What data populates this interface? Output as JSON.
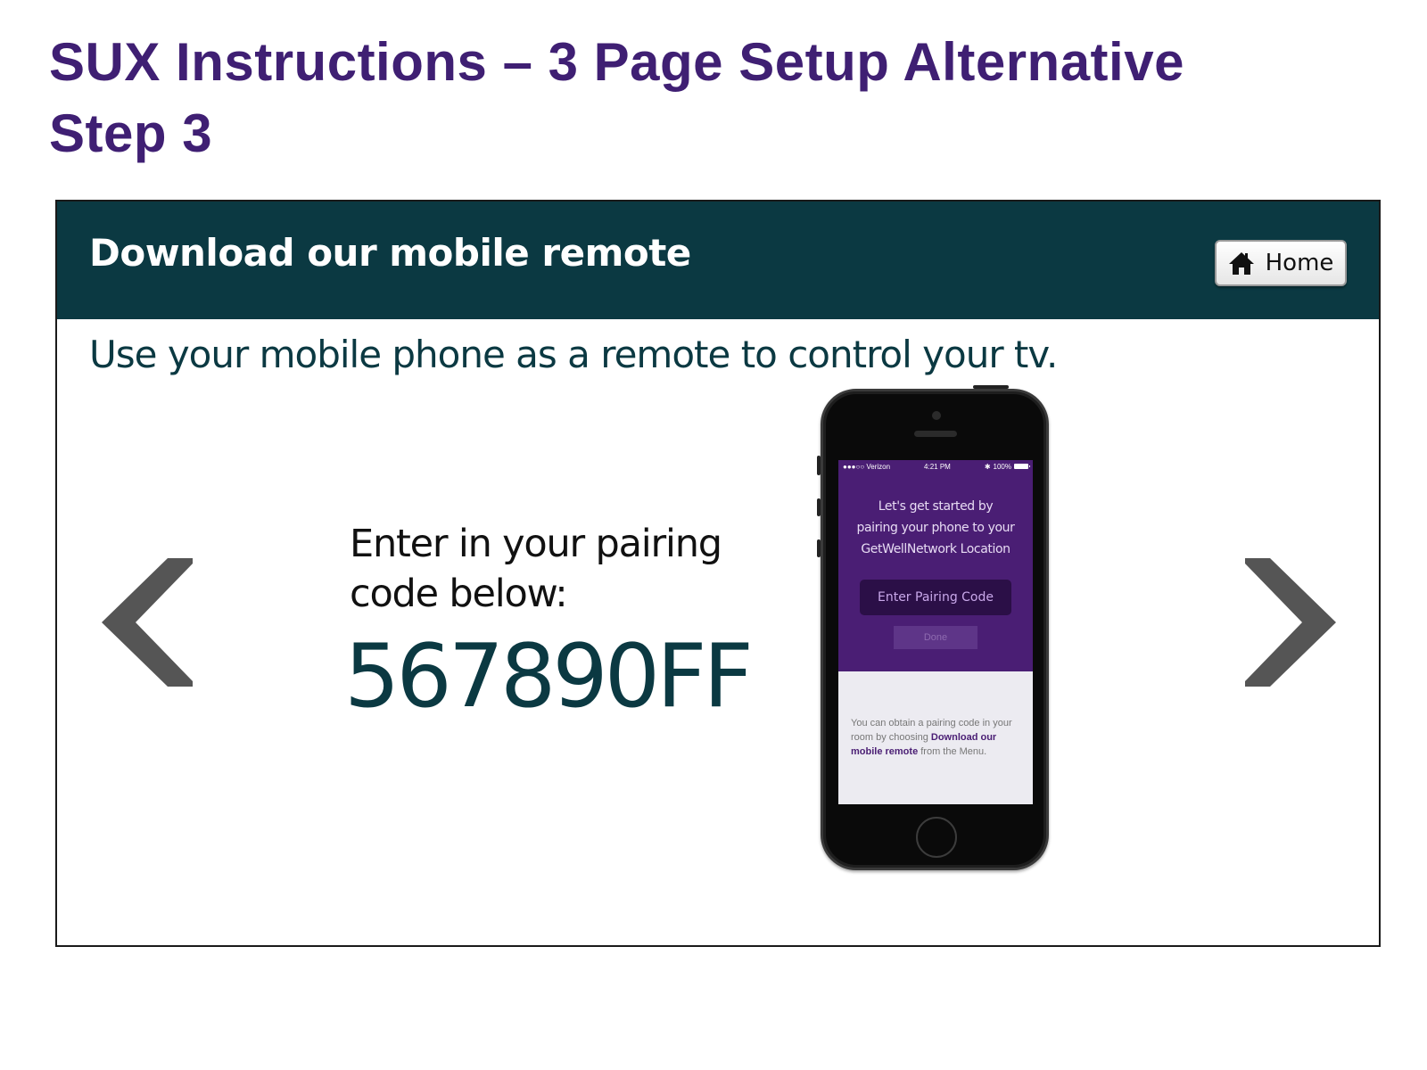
{
  "slide": {
    "title_line1": "SUX Instructions – 3 Page Setup Alternative",
    "title_line2": "Step 3"
  },
  "header": {
    "title": "Download our mobile remote",
    "home_label": "Home"
  },
  "main": {
    "subtitle": "Use your mobile phone as a remote to control your tv.",
    "prompt_line1": "Enter in your pairing",
    "prompt_line2": "code below:",
    "pairing_code": "567890FF"
  },
  "phone": {
    "carrier": "●●●○○ Verizon",
    "time": "4:21 PM",
    "battery": "100%",
    "intro_line1": "Let's get started by",
    "intro_line2": "pairing your phone to your",
    "intro_line3": "GetWellNetwork Location",
    "enter_code_button": "Enter Pairing Code",
    "done_button": "Done",
    "help_prefix": "You can obtain a pairing code in your room by choosing ",
    "help_link": "Download our mobile remote",
    "help_suffix": " from the Menu."
  },
  "icons": {
    "home": "home-icon",
    "prev": "chevron-left-icon",
    "next": "chevron-right-icon"
  },
  "colors": {
    "slide_title": "#3f1f73",
    "header_bg": "#0b3942",
    "pairing_code": "#0b3942",
    "phone_screen": "#4a1e74",
    "arrow": "#555555"
  }
}
